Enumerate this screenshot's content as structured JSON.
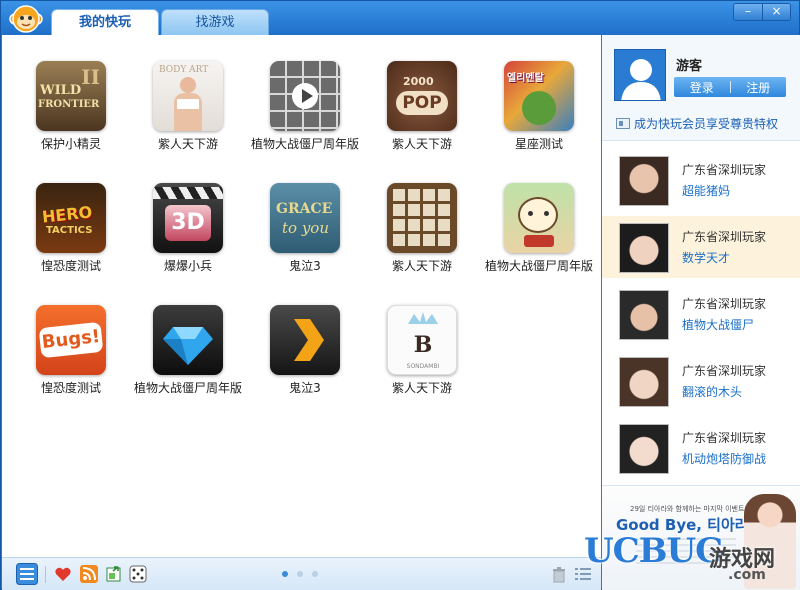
{
  "tabs": [
    {
      "label": "我的快玩",
      "active": true
    },
    {
      "label": "找游戏",
      "active": false
    }
  ],
  "window_controls": {
    "minimize": "–",
    "close": "×"
  },
  "games": [
    {
      "name": "保护小精灵",
      "icon": "wild-frontier-icon"
    },
    {
      "name": "紫人天下游",
      "icon": "body-art-icon"
    },
    {
      "name": "植物大战僵尸周年版",
      "icon": "media-collage-icon"
    },
    {
      "name": "紫人天下游",
      "icon": "2000-pop-icon"
    },
    {
      "name": "星座测试",
      "icon": "elemental-icon"
    },
    {
      "name": "惶恐度测试",
      "icon": "hero-tactics-icon"
    },
    {
      "name": "爆爆小兵",
      "icon": "3d-clapper-icon"
    },
    {
      "name": "鬼泣3",
      "icon": "grace-to-you-icon"
    },
    {
      "name": "紫人天下游",
      "icon": "tile-board-icon"
    },
    {
      "name": "植物大战僵尸周年版",
      "icon": "cute-animals-icon"
    },
    {
      "name": "惶恐度测试",
      "icon": "bugs-icon"
    },
    {
      "name": "植物大战僵尸周年版",
      "icon": "diamond-icon"
    },
    {
      "name": "鬼泣3",
      "icon": "chevron-play-icon"
    },
    {
      "name": "紫人天下游",
      "icon": "sondambi-crown-icon"
    }
  ],
  "profile": {
    "name": "游客",
    "login_label": "登录",
    "register_label": "注册",
    "vip_text": "成为快玩会员享受尊贵特权"
  },
  "players": [
    {
      "location": "广东省深圳玩家",
      "game": "超能猪妈",
      "selected": false
    },
    {
      "location": "广东省深圳玩家",
      "game": "数学天才",
      "selected": true
    },
    {
      "location": "广东省深圳玩家",
      "game": "植物大战僵尸",
      "selected": false
    },
    {
      "location": "广东省深圳玩家",
      "game": "翻滚的木头",
      "selected": false
    },
    {
      "location": "广东省深圳玩家",
      "game": "机动炮塔防御战",
      "selected": false
    }
  ],
  "banner": {
    "headline": "Good Bye, 티아라",
    "subline": "29일 티아라와 함께하는 마지막 이벤트!"
  },
  "watermark": {
    "logo": "UCBUG",
    "cn": "游戏网",
    "com": ".com"
  },
  "pager": {
    "pages": 3,
    "current": 1
  },
  "colors": {
    "accent": "#2a7cd2",
    "link": "#1a6fc9",
    "selected_row": "#fdf3dc"
  }
}
